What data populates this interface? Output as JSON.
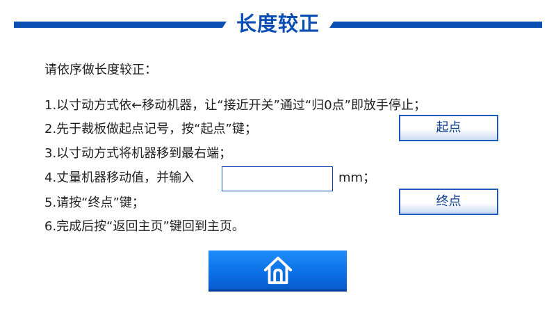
{
  "header": {
    "title": "长度较正"
  },
  "instructions": {
    "intro": "请依序做长度较正：",
    "step1": "1.以寸动方式依←移动机器，让“接近开关”通过“归0点”即放手停止；",
    "step2": "2.先于裁板做起点记号，按“起点”键；",
    "step3": "3.以寸动方式将机器移到最右端；",
    "step4": "4.丈量机器移动值，并输入",
    "step4_unit": "mm；",
    "step5": "5.请按“终点”键；",
    "step6": "6.完成后按“返回主页”键回到主页。"
  },
  "length_input": {
    "value": "",
    "placeholder": ""
  },
  "buttons": {
    "start_label": "起点",
    "end_label": "终点",
    "home_icon": "home-icon"
  },
  "colors": {
    "brand_blue": "#0a4db3",
    "home_button_blue": "#0b6fe6"
  }
}
